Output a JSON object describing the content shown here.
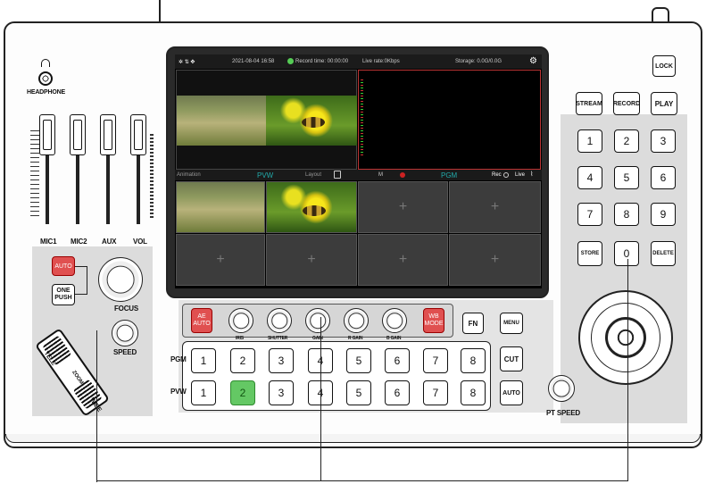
{
  "headphone": {
    "label": "HEADPHONE"
  },
  "audio": {
    "faders": [
      {
        "label": "MIC1"
      },
      {
        "label": "MIC2"
      },
      {
        "label": "AUX"
      },
      {
        "label": "VOL"
      }
    ]
  },
  "camera": {
    "auto_label": "AUTO",
    "one_push_label": "ONE PUSH",
    "focus_label": "FOCUS",
    "speed_label": "SPEED",
    "tele_label": "TELE",
    "zoom_label": "ZOOM",
    "wide_label": "WIDE"
  },
  "screen": {
    "status": {
      "datetime": "2021-08-04 16:58",
      "record_time": "Record time: 00:00:00",
      "live_rate": "Live rate:0Kbps",
      "storage": "Storage: 0.0G/0.0G"
    },
    "bar": {
      "animation": "Animation",
      "pvw": "PVW",
      "layout": "Layout",
      "m": "M",
      "pgm": "PGM",
      "rec": "Rec",
      "live": "Live"
    }
  },
  "controls": {
    "ae_auto": "AE AUTO",
    "wb_mode": "WB MODE",
    "knob_labels": [
      "IRIS",
      "SHUTTER",
      "GAIN",
      "R GAIN",
      "B GAIN"
    ],
    "fn": "FN",
    "menu": "MENU",
    "pgm_label": "PGM",
    "pvw_label": "PVW",
    "pgm_buttons": [
      "1",
      "2",
      "3",
      "4",
      "5",
      "6",
      "7",
      "8"
    ],
    "pvw_buttons": [
      "1",
      "2",
      "3",
      "4",
      "5",
      "6",
      "7",
      "8"
    ],
    "pvw_selected": 2,
    "cut": "CUT",
    "auto": "AUTO"
  },
  "top_right": {
    "lock": "LOCK",
    "stream": "STREAM",
    "record": "RECORD",
    "play": "PLAY"
  },
  "keypad": {
    "keys": [
      "1",
      "2",
      "3",
      "4",
      "5",
      "6",
      "7",
      "8",
      "9",
      "STORE",
      "0",
      "DELETE"
    ],
    "pt_speed": "PT SPEED"
  },
  "colors": {
    "selected_green": "#64c864",
    "red_button": "#e05050",
    "panel_gray": "#dcdcdc"
  }
}
